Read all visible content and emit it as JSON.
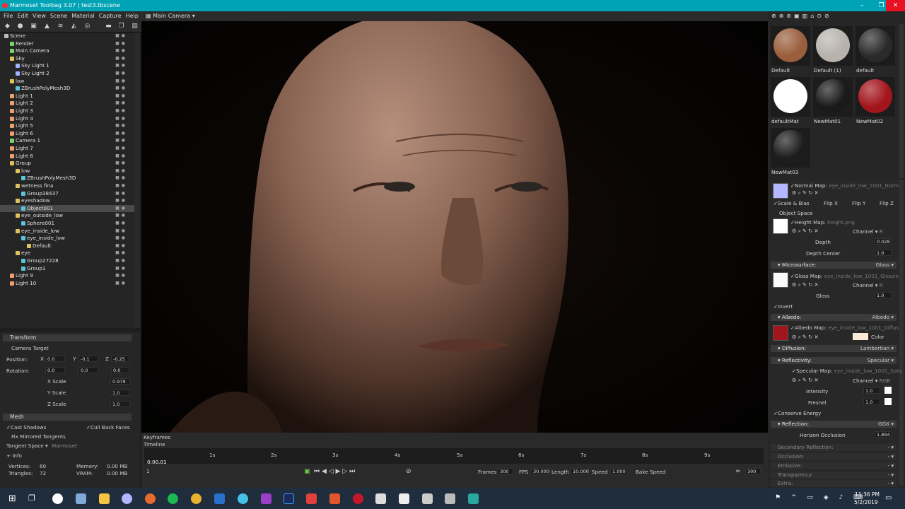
{
  "window": {
    "title": "Marmoset Toolbag 3.07  |  test3.tbscene",
    "min": "–",
    "max": "❐",
    "close": "✕"
  },
  "menu": [
    "File",
    "Edit",
    "View",
    "Scene",
    "Material",
    "Capture",
    "Help"
  ],
  "viewport": {
    "camera_label": "Main Camera ▾"
  },
  "outliner": [
    {
      "label": "Scene",
      "indent": 0,
      "color": "#bdbdbd"
    },
    {
      "label": "Render",
      "indent": 2,
      "color": "#79d36b"
    },
    {
      "label": "Main Camera",
      "indent": 2,
      "color": "#79d36b"
    },
    {
      "label": "Sky",
      "indent": 2,
      "color": "#e0c45a"
    },
    {
      "label": "Sky Light 1",
      "indent": 4,
      "color": "#9fb3ff"
    },
    {
      "label": "Sky Light 2",
      "indent": 4,
      "color": "#9fb3ff"
    },
    {
      "label": "low",
      "indent": 2,
      "color": "#e0c45a"
    },
    {
      "label": "ZBrushPolyMesh3D",
      "indent": 4,
      "color": "#5ac6d9"
    },
    {
      "label": "Light 1",
      "indent": 2,
      "color": "#f0a070"
    },
    {
      "label": "Light 2",
      "indent": 2,
      "color": "#f0a070"
    },
    {
      "label": "Light 3",
      "indent": 2,
      "color": "#f0a070"
    },
    {
      "label": "Light 4",
      "indent": 2,
      "color": "#f0a070"
    },
    {
      "label": "Light 5",
      "indent": 2,
      "color": "#f0a070"
    },
    {
      "label": "Light 6",
      "indent": 2,
      "color": "#f0a070"
    },
    {
      "label": "Camera 1",
      "indent": 2,
      "color": "#79d36b"
    },
    {
      "label": "Light 7",
      "indent": 2,
      "color": "#f0a070"
    },
    {
      "label": "Light 8",
      "indent": 2,
      "color": "#f0a070"
    },
    {
      "label": "Group",
      "indent": 2,
      "color": "#e0c45a"
    },
    {
      "label": "low",
      "indent": 4,
      "color": "#e0c45a"
    },
    {
      "label": "ZBrushPolyMesh3D",
      "indent": 6,
      "color": "#5ac6d9"
    },
    {
      "label": "wetness fina",
      "indent": 4,
      "color": "#e0c45a"
    },
    {
      "label": "Group38437",
      "indent": 6,
      "color": "#5ac6d9"
    },
    {
      "label": "eyeshadow",
      "indent": 4,
      "color": "#e0c45a"
    },
    {
      "label": "Object001",
      "indent": 6,
      "color": "#5ac6d9",
      "selected": "yes"
    },
    {
      "label": "eye_outside_low",
      "indent": 4,
      "color": "#e0c45a"
    },
    {
      "label": "Sphere001",
      "indent": 6,
      "color": "#5ac6d9"
    },
    {
      "label": "eye_inside_low",
      "indent": 4,
      "color": "#e0c45a"
    },
    {
      "label": "eye_inside_low",
      "indent": 6,
      "color": "#5ac6d9"
    },
    {
      "label": "Default",
      "indent": 8,
      "color": "#e0c45a"
    },
    {
      "label": "eye",
      "indent": 4,
      "color": "#e0c45a"
    },
    {
      "label": "Group27228",
      "indent": 6,
      "color": "#5ac6d9"
    },
    {
      "label": "Group1",
      "indent": 6,
      "color": "#5ac6d9"
    },
    {
      "label": "Light 9",
      "indent": 2,
      "color": "#f0a070"
    },
    {
      "label": "Light 10",
      "indent": 2,
      "color": "#f0a070"
    }
  ],
  "transform": {
    "header": "Transform",
    "camera_target": "Camera Target",
    "position_label": "Position:",
    "rotation_label": "Rotation:",
    "x": "X",
    "y": "Y",
    "z": "Z",
    "pos_x": "0.0",
    "pos_y": "-0.1",
    "pos_z": "-0.25",
    "rot_x": "0.0",
    "rot_y": "0.0",
    "rot_z": "0.0",
    "xscale_label": "X Scale",
    "xscale": "0.979",
    "yscale_label": "Y Scale",
    "yscale": "1.0",
    "zscale_label": "Z Scale",
    "zscale": "1.0"
  },
  "mesh": {
    "header": "Mesh",
    "cast_shadows": "Cast Shadows",
    "cull_back": "Cull Back Faces",
    "fix_mirrored": "Fix Mirrored Tangents",
    "tangent_space": "Tangent Space ▾",
    "tangent_value": "Marmoset",
    "info": "Info",
    "vertices_label": "Vertices:",
    "vertices": "60",
    "triangles_label": "Triangles:",
    "triangles": "72",
    "memory_label": "Memory:",
    "memory": "0.00 MB",
    "vram_label": "VRAM:",
    "vram": "0.00 MB"
  },
  "timeline": {
    "keyframes": "Keyframes",
    "timeline": "Timeline",
    "ticks": [
      "1s",
      "2s",
      "3s",
      "4s",
      "5s",
      "6s",
      "7s",
      "8s",
      "9s"
    ],
    "current": "0:00.01",
    "frame": "1",
    "frames_label": "Frames",
    "frames": "300",
    "fps_label": "FPS",
    "fps": "30.000",
    "length_label": "Length",
    "length": "10.000",
    "speed_label": "Speed",
    "speed": "1.000",
    "bake_speed": "Bake Speed",
    "end": "300"
  },
  "materials": [
    {
      "name": "Default",
      "color": "#9a5e3c"
    },
    {
      "name": "Default (1)",
      "color": "#b7b2ac"
    },
    {
      "name": "default",
      "color": "#2a2a2a"
    },
    {
      "name": "defaultMat",
      "color": "#ffffff"
    },
    {
      "name": "NewMat01",
      "color": "#1a1a1a"
    },
    {
      "name": "NewMat02",
      "color": "#a3151c"
    },
    {
      "name": "NewMat03",
      "color": "#1d1d1d"
    }
  ],
  "props": {
    "normal_map": "Normal Map:",
    "normal_file": "eye_inside_low_1001_Norm",
    "scale_bias": "Scale & Bias",
    "flip_x": "Flip X",
    "flip_y": "Flip Y",
    "flip_z": "Flip Z",
    "object_space": "Object Space",
    "height_map": "Height Map:",
    "height_file": "height.png",
    "channel": "Channel ▾",
    "channel_r": "R",
    "depth_label": "Depth",
    "depth": "0.028",
    "depth_center_label": "Depth Center",
    "depth_center": "1.0",
    "microsurface": "Microsurface:",
    "microsurface_type": "Gloss ▾",
    "gloss_map": "Gloss Map:",
    "gloss_file": "eye_inside_low_1001_Glossin",
    "gloss_label": "Gloss",
    "gloss": "1.0",
    "invert": "Invert",
    "albedo": "Albedo:",
    "albedo_type": "Albedo ▾",
    "albedo_map": "Albedo Map:",
    "albedo_file": "eye_inside_low_1001_Diffus",
    "color_label": "Color",
    "diffusion": "Diffusion:",
    "diffusion_type": "Lambertian ▾",
    "reflectivity": "Reflectivity:",
    "reflectivity_type": "Specular ▾",
    "specular_map": "Specular Map:",
    "specular_file": "eye_inside_low_1001_Spec",
    "channel_rgb": "RGB",
    "intensity_label": "Intensity",
    "intensity": "1.0",
    "fresnel_label": "Fresnel",
    "fresnel": "1.0",
    "conserve": "Conserve Energy",
    "reflection": "Reflection:",
    "reflection_type": "GGX ▾",
    "horizon_label": "Horizon Occlusion",
    "horizon": "1.894",
    "secondary": "Secondary Reflection:",
    "occlusion": "Occlusion:",
    "emissive": "Emissive:",
    "transparency": "Transparency:",
    "extra": "Extra:",
    "dash": "- ▾"
  },
  "taskbar": {
    "time": "11:36 PM",
    "date": "5/2/2019"
  }
}
